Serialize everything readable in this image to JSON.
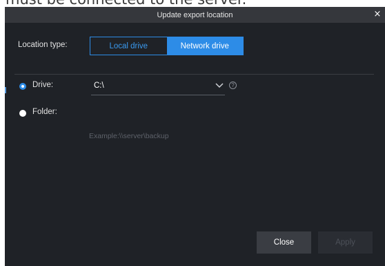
{
  "background_text": "must be connected to the server.",
  "dialog": {
    "title": "Update export location",
    "close_glyph": "×"
  },
  "location_type": {
    "label": "Location type:",
    "options": [
      "Local drive",
      "Network drive"
    ],
    "selected": "Network drive"
  },
  "drive": {
    "label": "Drive:",
    "value": "C:\\",
    "selected": true
  },
  "folder": {
    "label": "Folder:",
    "value": "",
    "placeholder": "Example:\\\\server\\backup",
    "selected": false
  },
  "buttons": {
    "close": "Close",
    "apply": "Apply"
  },
  "colors": {
    "accent": "#2d8ce7",
    "dialog_bg": "#1f2227",
    "titlebar_bg": "#35373c"
  }
}
